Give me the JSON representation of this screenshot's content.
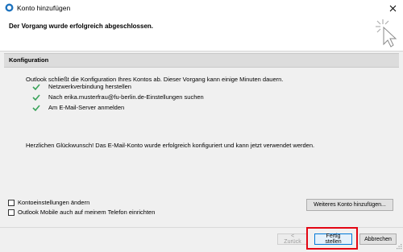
{
  "window": {
    "title": "Konto hinzufügen"
  },
  "header": {
    "title": "Der Vorgang wurde erfolgreich abgeschlossen."
  },
  "section": {
    "title": "Konfiguration"
  },
  "intro_text": "Outlook schließt die Konfiguration Ihres Kontos ab. Dieser Vorgang kann einige Minuten dauern.",
  "steps": [
    {
      "label": "Netzwerkverbindung herstellen",
      "icon": "checkmark-icon"
    },
    {
      "label": "Nach erika.musterfrau@fu-berlin.de-Einstellungen suchen",
      "icon": "checkmark-icon"
    },
    {
      "label": "Am E-Mail-Server anmelden",
      "icon": "checkmark-icon"
    }
  ],
  "congrats_text": "Herzlichen Glückwunsch! Das E-Mail-Konto wurde erfolgreich konfiguriert und kann jetzt verwendet werden.",
  "options": [
    {
      "label": "Kontoeinstellungen ändern",
      "checked": false
    },
    {
      "label": "Outlook Mobile auch auf meinem Telefon einrichten",
      "checked": false
    }
  ],
  "buttons": {
    "more_account": "Weiteres Konto hinzufügen...",
    "back": "< Zurück",
    "finish": "Fertig stellen",
    "cancel": "Abbrechen"
  },
  "colors": {
    "check": "#3aa35b",
    "accent": "#0078d7",
    "highlight": "#e30613"
  }
}
